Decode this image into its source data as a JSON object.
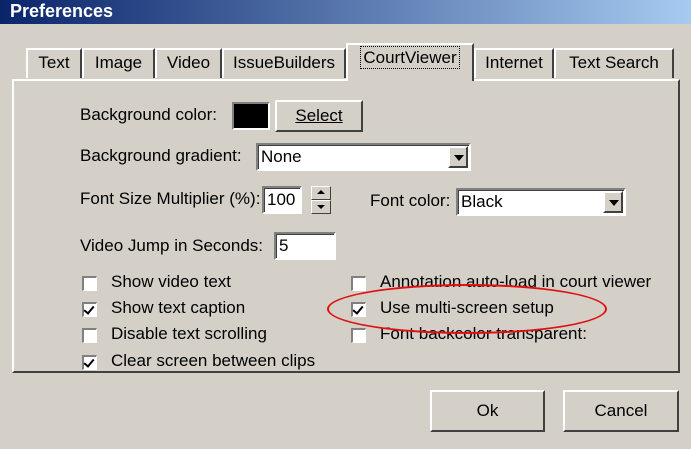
{
  "window": {
    "title": "Preferences"
  },
  "tabs": [
    "Text",
    "Image",
    "Video",
    "IssueBuilders",
    "CourtViewer",
    "Internet",
    "Text Search"
  ],
  "active_tab": "CourtViewer",
  "courtviewer": {
    "background_color_label": "Background color:",
    "background_color_value": "#000000",
    "select_button": "Select",
    "background_gradient_label": "Background gradient:",
    "background_gradient_value": "None",
    "font_size_multiplier_label": "Font Size Multiplier (%):",
    "font_size_multiplier_value": "100",
    "font_color_label": "Font color:",
    "font_color_value": "Black",
    "video_jump_label": "Video Jump in Seconds:",
    "video_jump_value": "5",
    "checkboxes_left": [
      {
        "label": "Show video text",
        "checked": false
      },
      {
        "label": "Show text caption",
        "checked": true
      },
      {
        "label": "Disable text scrolling",
        "checked": false
      },
      {
        "label": "Clear screen between clips",
        "checked": true
      }
    ],
    "checkboxes_right": [
      {
        "label": "Annotation auto-load in court viewer",
        "checked": false
      },
      {
        "label": "Use multi-screen setup",
        "checked": true
      },
      {
        "label": "Font backcolor transparent:",
        "checked": false
      }
    ]
  },
  "buttons": {
    "ok": "Ok",
    "cancel": "Cancel"
  },
  "annotation": {
    "highlight_color": "#e01010"
  }
}
